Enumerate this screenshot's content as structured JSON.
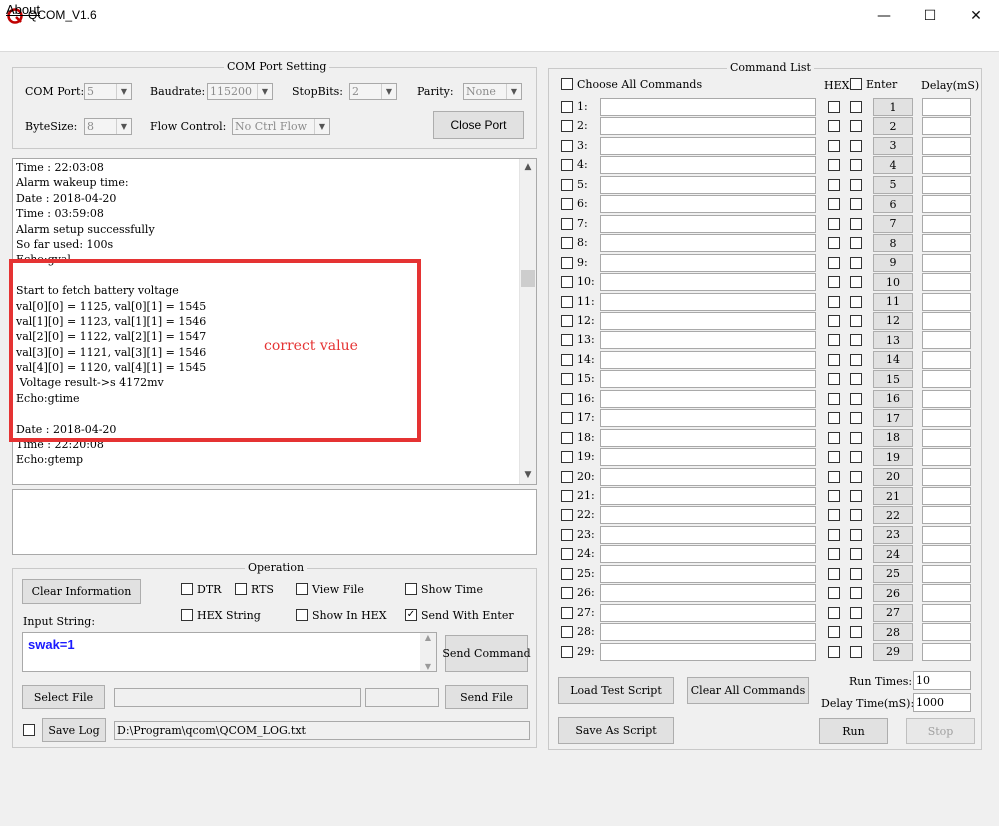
{
  "window": {
    "title": "QCOM_V1.6",
    "controls": {
      "minimize": "—",
      "maximize": "☐",
      "close": "✕"
    }
  },
  "menu": {
    "about": "About"
  },
  "com_port_setting": {
    "title": "COM Port Setting",
    "com_port_label": "COM Port:",
    "com_port_value": "5",
    "baudrate_label": "Baudrate:",
    "baudrate_value": "115200",
    "stopbits_label": "StopBits:",
    "stopbits_value": "2",
    "parity_label": "Parity:",
    "parity_value": "None",
    "bytesize_label": "ByteSize:",
    "bytesize_value": "8",
    "flow_control_label": "Flow Control:",
    "flow_control_value": "No Ctrl Flow",
    "close_port_button": "Close Port"
  },
  "log": {
    "lines": [
      "Time : 22:03:08",
      "Alarm wakeup time:",
      "Date : 2018-04-20",
      "Time : 03:59:08",
      "Alarm setup successfully",
      "So far used: 100s",
      "Echo:gval",
      "",
      "Start to fetch battery voltage",
      "val[0][0] = 1125, val[0][1] = 1545",
      "val[1][0] = 1123, val[1][1] = 1546",
      "val[2][0] = 1122, val[2][1] = 1547",
      "val[3][0] = 1121, val[3][1] = 1546",
      "val[4][0] = 1120, val[4][1] = 1545",
      " Voltage result->s 4172mv",
      "Echo:gtime",
      "",
      "Date : 2018-04-20",
      "Time : 22:20:08",
      "Echo:gtemp"
    ],
    "annotation": "correct value"
  },
  "operation": {
    "title": "Operation",
    "clear_information_button": "Clear Information",
    "dtr_label": "DTR",
    "rts_label": "RTS",
    "view_file_label": "View File",
    "show_time_label": "Show Time",
    "hex_string_label": "HEX String",
    "show_in_hex_label": "Show In HEX",
    "send_with_enter_label": "Send With Enter",
    "send_with_enter_checked": "✓",
    "input_string_label": "Input String:",
    "input_string_value": "swak=1",
    "send_command_button": "Send Command",
    "select_file_button": "Select File",
    "send_file_button": "Send File",
    "save_log_button": "Save Log",
    "log_path": "D:\\Program\\qcom\\QCOM_LOG.txt"
  },
  "command_list": {
    "title": "Command List",
    "choose_all_label": "Choose All Commands",
    "hex_header": "HEX",
    "enter_header": "Enter",
    "delay_header": "Delay(mS)",
    "rows": [
      {
        "num": "1:",
        "send": "1"
      },
      {
        "num": "2:",
        "send": "2"
      },
      {
        "num": "3:",
        "send": "3"
      },
      {
        "num": "4:",
        "send": "4"
      },
      {
        "num": "5:",
        "send": "5"
      },
      {
        "num": "6:",
        "send": "6"
      },
      {
        "num": "7:",
        "send": "7"
      },
      {
        "num": "8:",
        "send": "8"
      },
      {
        "num": "9:",
        "send": "9"
      },
      {
        "num": "10:",
        "send": "10"
      },
      {
        "num": "11:",
        "send": "11"
      },
      {
        "num": "12:",
        "send": "12"
      },
      {
        "num": "13:",
        "send": "13"
      },
      {
        "num": "14:",
        "send": "14"
      },
      {
        "num": "15:",
        "send": "15"
      },
      {
        "num": "16:",
        "send": "16"
      },
      {
        "num": "17:",
        "send": "17"
      },
      {
        "num": "18:",
        "send": "18"
      },
      {
        "num": "19:",
        "send": "19"
      },
      {
        "num": "20:",
        "send": "20"
      },
      {
        "num": "21:",
        "send": "21"
      },
      {
        "num": "22:",
        "send": "22"
      },
      {
        "num": "23:",
        "send": "23"
      },
      {
        "num": "24:",
        "send": "24"
      },
      {
        "num": "25:",
        "send": "25"
      },
      {
        "num": "26:",
        "send": "26"
      },
      {
        "num": "27:",
        "send": "27"
      },
      {
        "num": "28:",
        "send": "28"
      },
      {
        "num": "29:",
        "send": "29"
      }
    ],
    "load_test_script_button": "Load Test Script",
    "clear_all_commands_button": "Clear All Commands",
    "save_as_script_button": "Save As Script",
    "run_times_label": "Run Times:",
    "run_times_value": "10",
    "delay_time_label": "Delay Time(mS):",
    "delay_time_value": "1000",
    "run_button": "Run",
    "stop_button": "Stop"
  },
  "colors": {
    "highlight": "#e53333",
    "input_text": "#1a1aff",
    "window_bg": "#f0f0f0"
  }
}
